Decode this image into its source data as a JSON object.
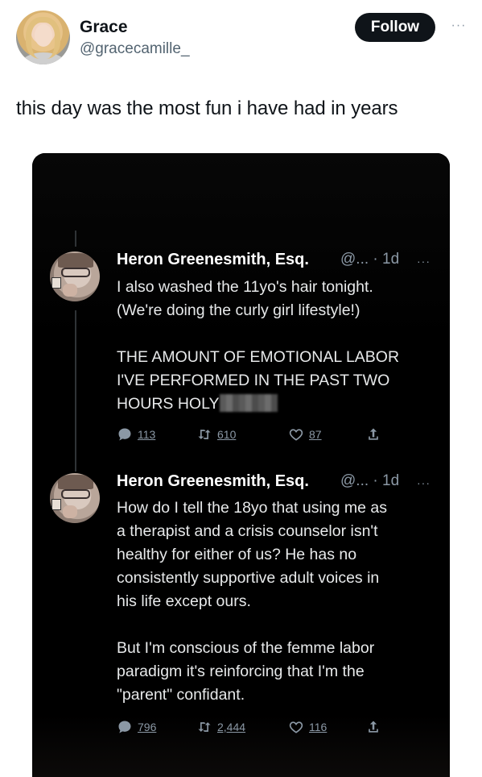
{
  "post": {
    "author_name": "Grace",
    "author_handle": "@gracecamille_",
    "follow_label": "Follow",
    "more_label": "···",
    "text": "this day was the most fun i have had in years"
  },
  "media": {
    "tweets": [
      {
        "name": "Heron Greenesmith, Esq.",
        "meta": "@... · 1d",
        "more": "···",
        "lines": [
          "I also washed the 11yo's hair tonight.",
          "(We're doing the curly girl lifestyle!)",
          "",
          "THE AMOUNT OF EMOTIONAL LABOR",
          "I'VE PERFORMED IN THE PAST TWO",
          "HOURS HOLY"
        ],
        "replies": "113",
        "retweets": "610",
        "likes": "87"
      },
      {
        "name": "Heron Greenesmith, Esq.",
        "meta": "@... · 1d",
        "more": "···",
        "lines": [
          "How do I tell the 18yo that using me as",
          "a therapist and a crisis counselor isn't",
          "healthy for either of us? He has no",
          "consistently supportive adult voices in",
          "his life except ours.",
          "",
          "But I'm conscious of the femme labor",
          "paradigm it's reinforcing that I'm the",
          "\"parent\" confidant."
        ],
        "replies": "796",
        "retweets": "2,444",
        "likes": "116"
      }
    ]
  },
  "colors": {
    "follow_bg": "#0f1419",
    "media_bg": "#000000",
    "muted": "#8b98a5"
  }
}
